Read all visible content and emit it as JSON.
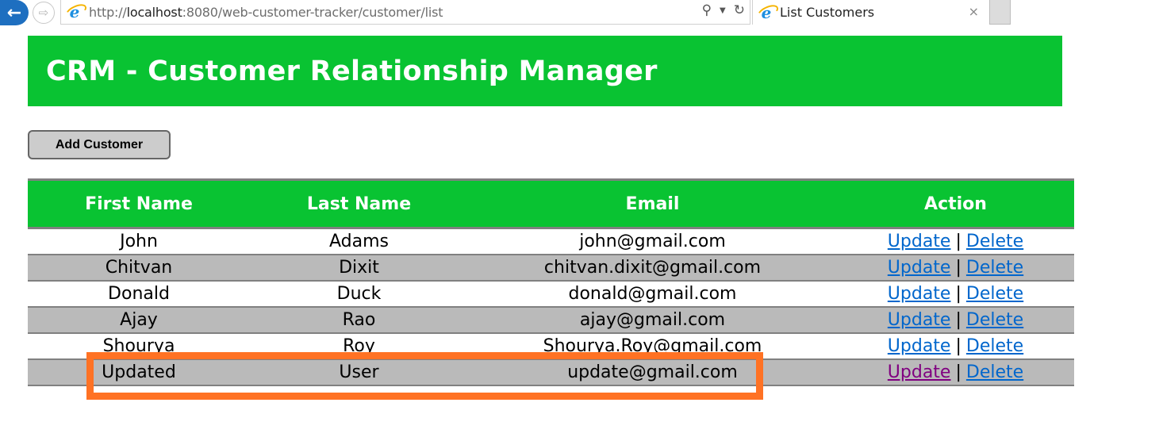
{
  "browser": {
    "url_prefix": "http://",
    "url_host": "localhost",
    "url_rest": ":8080/web-customer-tracker/customer/list",
    "tab_title": "List Customers",
    "icons": [
      "back-arrow-icon",
      "forward-arrow-icon",
      "ie-logo-icon",
      "search-icon",
      "dropdown-icon",
      "refresh-icon",
      "close-icon"
    ]
  },
  "page": {
    "header_title": "CRM - Customer Relationship Manager",
    "add_button_label": "Add Customer",
    "accent_color": "#09c332",
    "highlight_color": "#ff7224"
  },
  "table": {
    "columns": [
      "First Name",
      "Last Name",
      "Email",
      "Action"
    ],
    "update_label": "Update",
    "delete_label": "Delete",
    "separator": "|",
    "rows": [
      {
        "first_name": "John",
        "last_name": "Adams",
        "email": "john@gmail.com"
      },
      {
        "first_name": "Chitvan",
        "last_name": "Dixit",
        "email": "chitvan.dixit@gmail.com"
      },
      {
        "first_name": "Donald",
        "last_name": "Duck",
        "email": "donald@gmail.com"
      },
      {
        "first_name": "Ajay",
        "last_name": "Rao",
        "email": "ajay@gmail.com"
      },
      {
        "first_name": "Shourya",
        "last_name": "Roy",
        "email": "Shourya.Roy@gmail.com"
      },
      {
        "first_name": "Updated",
        "last_name": "User",
        "email": "update@gmail.com",
        "update_visited": true,
        "highlighted": true
      }
    ]
  }
}
